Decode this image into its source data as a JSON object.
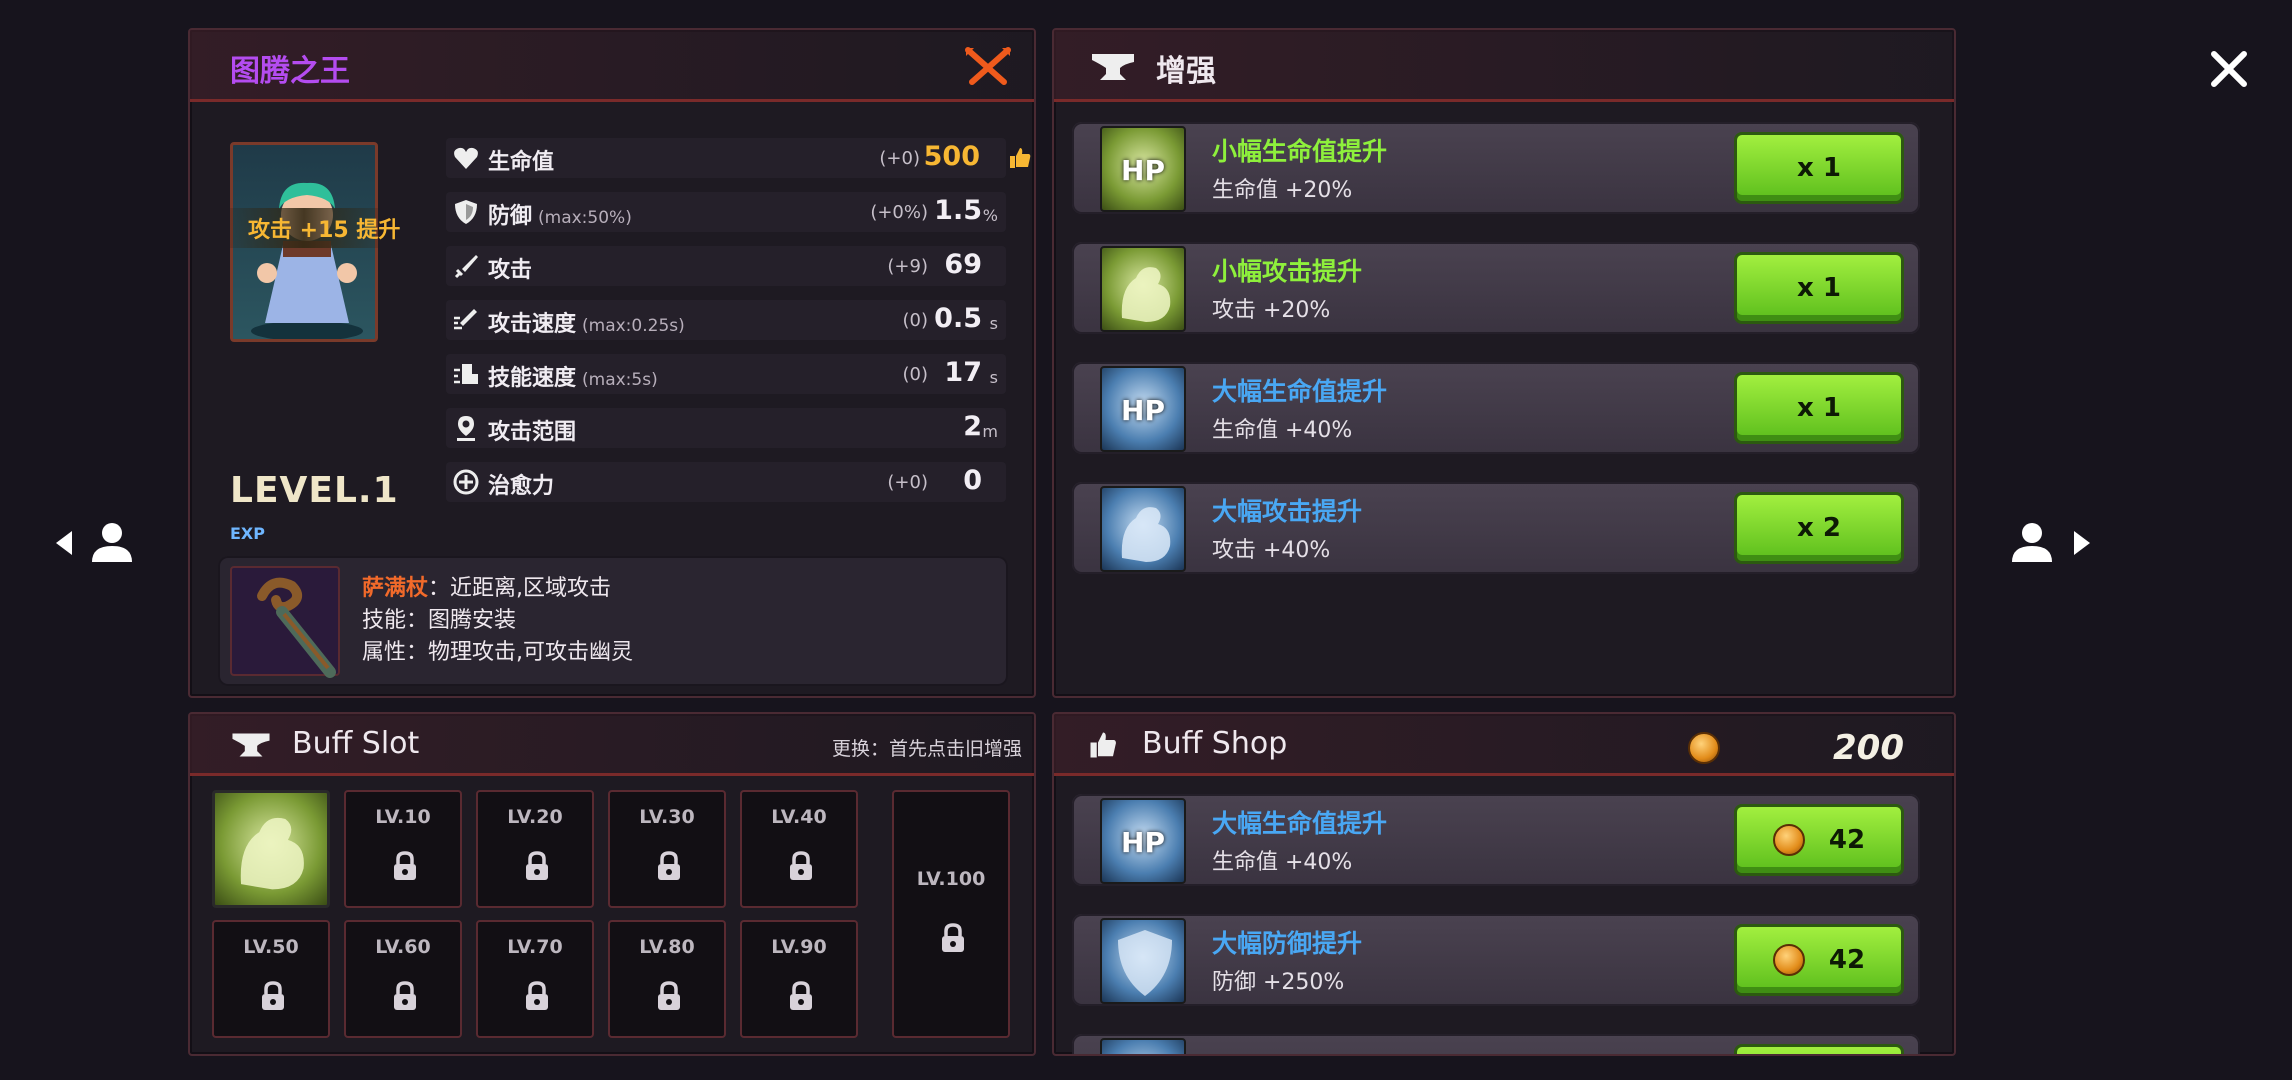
{
  "hero": {
    "title": "图腾之王",
    "level": "LEVEL.1",
    "exp_label": "EXP",
    "portrait_bonus": "攻击 +15 提升",
    "stats": [
      {
        "name": "生命值",
        "sub": "",
        "delta": "(+0)",
        "value": "500",
        "unit": "",
        "icon": "heart-icon",
        "value_color": "#f7b733"
      },
      {
        "name": "防御",
        "sub": "(max:50%)",
        "delta": "(+0%)",
        "value": "1.5",
        "unit": "%",
        "icon": "shield-icon",
        "value_color": "#f2eef4"
      },
      {
        "name": "攻击",
        "sub": "",
        "delta": "(+9)",
        "value": "69",
        "unit": "",
        "icon": "sword-icon",
        "value_color": "#f2eef4"
      },
      {
        "name": "攻击速度",
        "sub": "(max:0.25s)",
        "delta": "(0)",
        "value": "0.5",
        "unit": "s",
        "icon": "attack-speed-icon",
        "value_color": "#f2eef4"
      },
      {
        "name": "技能速度",
        "sub": "(max:5s)",
        "delta": "(0)",
        "value": "17",
        "unit": "s",
        "icon": "skill-speed-icon",
        "value_color": "#f2eef4"
      },
      {
        "name": "攻击范围",
        "sub": "",
        "delta": "",
        "value": "2",
        "unit": "m",
        "icon": "range-pin-icon",
        "value_color": "#f2eef4"
      },
      {
        "name": "治愈力",
        "sub": "",
        "delta": "(+0)",
        "value": "0",
        "unit": "",
        "icon": "heal-icon",
        "value_color": "#f2eef4"
      }
    ],
    "weapon": {
      "line1_name": "萨满杖",
      "line1_rest": "：近距离,区域攻击",
      "line2": "技能：图腾安装",
      "line3": "属性：物理攻击,可攻击幽灵"
    }
  },
  "enhance": {
    "title": "增强",
    "items": [
      {
        "name": "小幅生命值提升",
        "desc": "生命值 +20%",
        "tier": "green",
        "thumb": "HP",
        "button": "x 1"
      },
      {
        "name": "小幅攻击提升",
        "desc": "攻击 +20%",
        "tier": "green",
        "thumb": "",
        "button": "x 1"
      },
      {
        "name": "大幅生命值提升",
        "desc": "生命值 +40%",
        "tier": "blue",
        "thumb": "HP",
        "button": "x 1"
      },
      {
        "name": "大幅攻击提升",
        "desc": "攻击 +40%",
        "tier": "blue",
        "thumb": "",
        "button": "x 2"
      }
    ]
  },
  "buff_slot": {
    "title": "Buff Slot",
    "hint": "更换：首先点击旧增强",
    "slots": [
      "",
      "LV.10",
      "LV.20",
      "LV.30",
      "LV.40",
      "LV.50",
      "LV.60",
      "LV.70",
      "LV.80",
      "LV.90"
    ],
    "big_slot": "LV.100"
  },
  "buff_shop": {
    "title": "Buff Shop",
    "coins": "200",
    "items": [
      {
        "name": "大幅生命值提升",
        "desc": "生命值 +40%",
        "thumb": "HP",
        "price": "42"
      },
      {
        "name": "大幅防御提升",
        "desc": "防御 +250%",
        "thumb": "",
        "price": "42"
      }
    ]
  },
  "colors": {
    "hero_title": "#b44cf0",
    "green_text": "#8ef03c",
    "blue_text": "#49a7f3",
    "weapon_name": "#f26a2a",
    "accent_red": "#7a2a2a"
  }
}
